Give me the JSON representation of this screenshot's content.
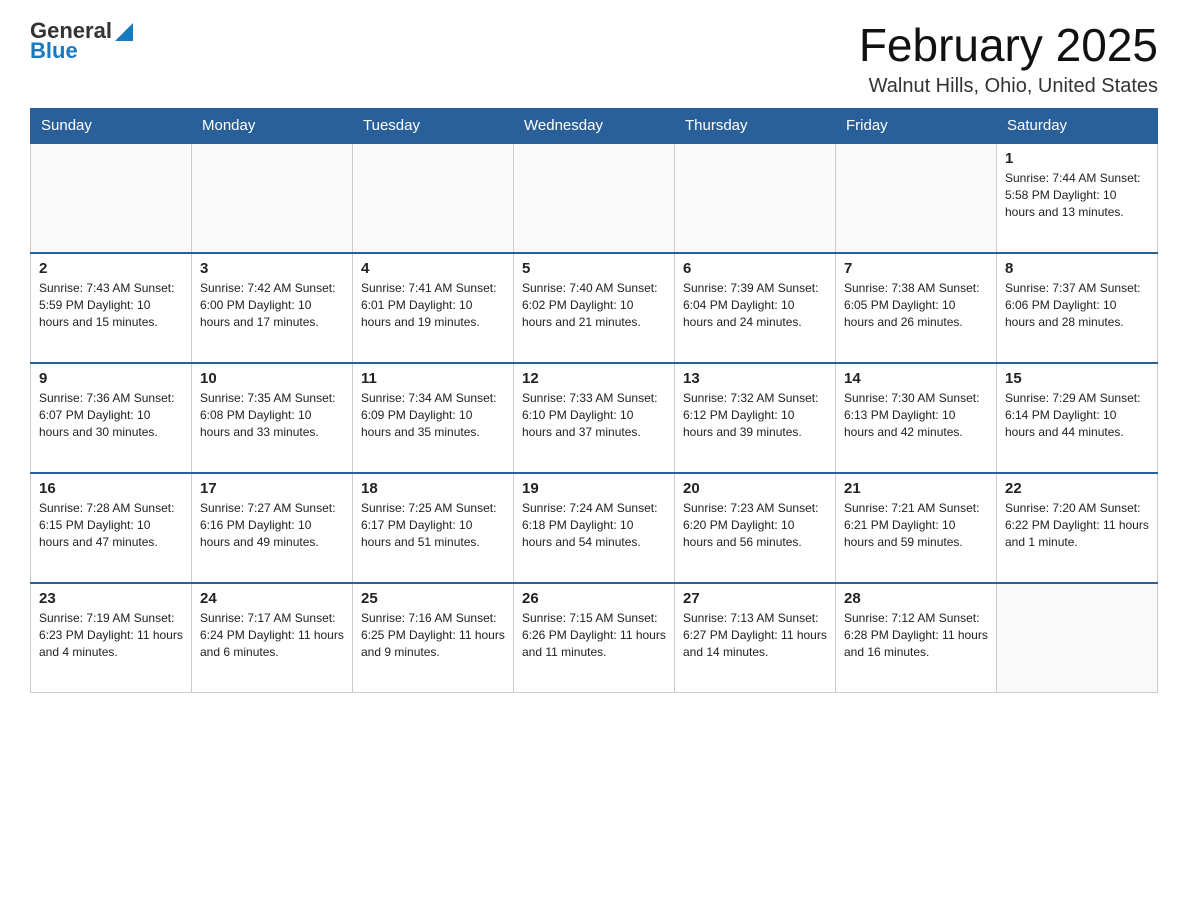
{
  "logo": {
    "general": "General",
    "blue": "Blue"
  },
  "title": "February 2025",
  "location": "Walnut Hills, Ohio, United States",
  "headers": [
    "Sunday",
    "Monday",
    "Tuesday",
    "Wednesday",
    "Thursday",
    "Friday",
    "Saturday"
  ],
  "weeks": [
    [
      {
        "day": "",
        "info": ""
      },
      {
        "day": "",
        "info": ""
      },
      {
        "day": "",
        "info": ""
      },
      {
        "day": "",
        "info": ""
      },
      {
        "day": "",
        "info": ""
      },
      {
        "day": "",
        "info": ""
      },
      {
        "day": "1",
        "info": "Sunrise: 7:44 AM\nSunset: 5:58 PM\nDaylight: 10 hours\nand 13 minutes."
      }
    ],
    [
      {
        "day": "2",
        "info": "Sunrise: 7:43 AM\nSunset: 5:59 PM\nDaylight: 10 hours\nand 15 minutes."
      },
      {
        "day": "3",
        "info": "Sunrise: 7:42 AM\nSunset: 6:00 PM\nDaylight: 10 hours\nand 17 minutes."
      },
      {
        "day": "4",
        "info": "Sunrise: 7:41 AM\nSunset: 6:01 PM\nDaylight: 10 hours\nand 19 minutes."
      },
      {
        "day": "5",
        "info": "Sunrise: 7:40 AM\nSunset: 6:02 PM\nDaylight: 10 hours\nand 21 minutes."
      },
      {
        "day": "6",
        "info": "Sunrise: 7:39 AM\nSunset: 6:04 PM\nDaylight: 10 hours\nand 24 minutes."
      },
      {
        "day": "7",
        "info": "Sunrise: 7:38 AM\nSunset: 6:05 PM\nDaylight: 10 hours\nand 26 minutes."
      },
      {
        "day": "8",
        "info": "Sunrise: 7:37 AM\nSunset: 6:06 PM\nDaylight: 10 hours\nand 28 minutes."
      }
    ],
    [
      {
        "day": "9",
        "info": "Sunrise: 7:36 AM\nSunset: 6:07 PM\nDaylight: 10 hours\nand 30 minutes."
      },
      {
        "day": "10",
        "info": "Sunrise: 7:35 AM\nSunset: 6:08 PM\nDaylight: 10 hours\nand 33 minutes."
      },
      {
        "day": "11",
        "info": "Sunrise: 7:34 AM\nSunset: 6:09 PM\nDaylight: 10 hours\nand 35 minutes."
      },
      {
        "day": "12",
        "info": "Sunrise: 7:33 AM\nSunset: 6:10 PM\nDaylight: 10 hours\nand 37 minutes."
      },
      {
        "day": "13",
        "info": "Sunrise: 7:32 AM\nSunset: 6:12 PM\nDaylight: 10 hours\nand 39 minutes."
      },
      {
        "day": "14",
        "info": "Sunrise: 7:30 AM\nSunset: 6:13 PM\nDaylight: 10 hours\nand 42 minutes."
      },
      {
        "day": "15",
        "info": "Sunrise: 7:29 AM\nSunset: 6:14 PM\nDaylight: 10 hours\nand 44 minutes."
      }
    ],
    [
      {
        "day": "16",
        "info": "Sunrise: 7:28 AM\nSunset: 6:15 PM\nDaylight: 10 hours\nand 47 minutes."
      },
      {
        "day": "17",
        "info": "Sunrise: 7:27 AM\nSunset: 6:16 PM\nDaylight: 10 hours\nand 49 minutes."
      },
      {
        "day": "18",
        "info": "Sunrise: 7:25 AM\nSunset: 6:17 PM\nDaylight: 10 hours\nand 51 minutes."
      },
      {
        "day": "19",
        "info": "Sunrise: 7:24 AM\nSunset: 6:18 PM\nDaylight: 10 hours\nand 54 minutes."
      },
      {
        "day": "20",
        "info": "Sunrise: 7:23 AM\nSunset: 6:20 PM\nDaylight: 10 hours\nand 56 minutes."
      },
      {
        "day": "21",
        "info": "Sunrise: 7:21 AM\nSunset: 6:21 PM\nDaylight: 10 hours\nand 59 minutes."
      },
      {
        "day": "22",
        "info": "Sunrise: 7:20 AM\nSunset: 6:22 PM\nDaylight: 11 hours\nand 1 minute."
      }
    ],
    [
      {
        "day": "23",
        "info": "Sunrise: 7:19 AM\nSunset: 6:23 PM\nDaylight: 11 hours\nand 4 minutes."
      },
      {
        "day": "24",
        "info": "Sunrise: 7:17 AM\nSunset: 6:24 PM\nDaylight: 11 hours\nand 6 minutes."
      },
      {
        "day": "25",
        "info": "Sunrise: 7:16 AM\nSunset: 6:25 PM\nDaylight: 11 hours\nand 9 minutes."
      },
      {
        "day": "26",
        "info": "Sunrise: 7:15 AM\nSunset: 6:26 PM\nDaylight: 11 hours\nand 11 minutes."
      },
      {
        "day": "27",
        "info": "Sunrise: 7:13 AM\nSunset: 6:27 PM\nDaylight: 11 hours\nand 14 minutes."
      },
      {
        "day": "28",
        "info": "Sunrise: 7:12 AM\nSunset: 6:28 PM\nDaylight: 11 hours\nand 16 minutes."
      },
      {
        "day": "",
        "info": ""
      }
    ]
  ]
}
